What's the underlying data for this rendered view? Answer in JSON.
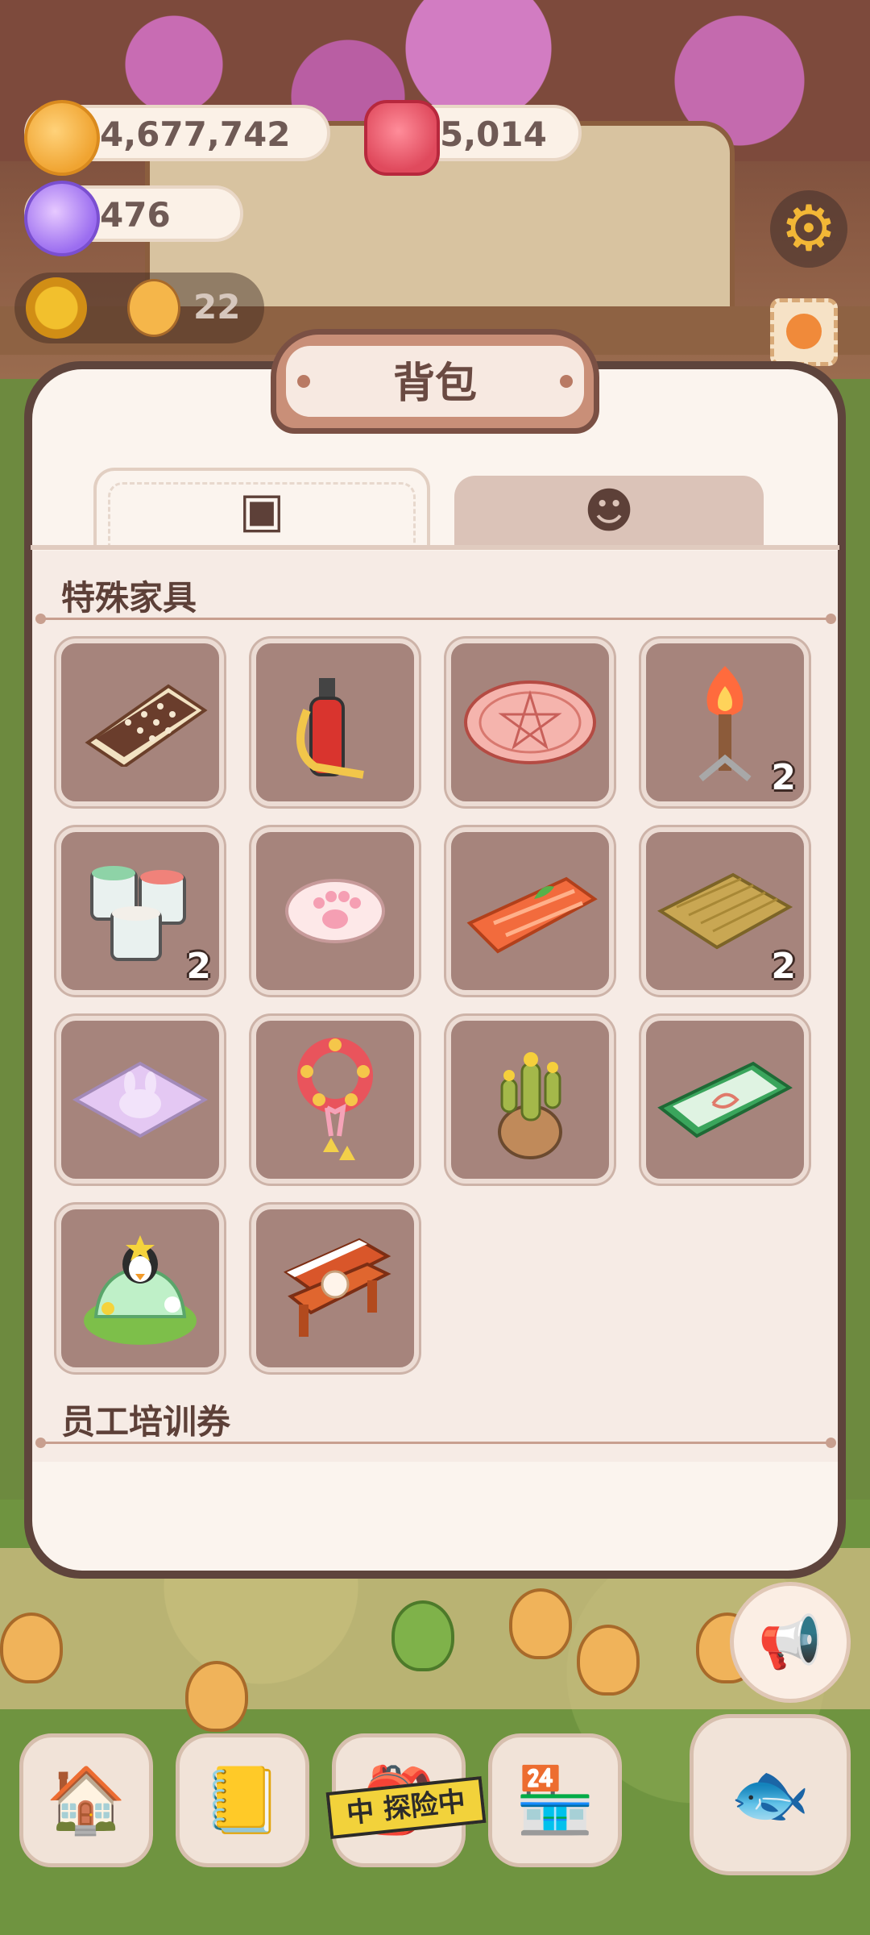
{
  "hud": {
    "coins": "4,677,742",
    "candles": "5,014",
    "gems": "476",
    "staff_count": "22",
    "icons": [
      "coin-icon",
      "candle-icon",
      "gem-icon",
      "sunflower-icon",
      "gear-icon",
      "stamp-icon"
    ]
  },
  "backpack": {
    "title": "背包",
    "tabs": [
      {
        "name": "furniture",
        "icon": "furniture-box-icon",
        "active": true
      },
      {
        "name": "staff",
        "icon": "chef-cat-icon",
        "active": false
      }
    ],
    "sections": [
      {
        "title": "特殊家具",
        "items": [
          {
            "name": "chocolate-biscuit-rug",
            "count": ""
          },
          {
            "name": "fire-extinguisher",
            "count": ""
          },
          {
            "name": "pentagram-rug",
            "count": ""
          },
          {
            "name": "torch",
            "count": "2"
          },
          {
            "name": "paint-buckets",
            "count": "2"
          },
          {
            "name": "paw-print-rug",
            "count": ""
          },
          {
            "name": "salmon-cushion",
            "count": ""
          },
          {
            "name": "bamboo-mat",
            "count": "2"
          },
          {
            "name": "bunny-rug",
            "count": ""
          },
          {
            "name": "flower-wreath",
            "count": ""
          },
          {
            "name": "cactus-pot",
            "count": ""
          },
          {
            "name": "green-rug",
            "count": ""
          },
          {
            "name": "penguin-jelly-cake",
            "count": ""
          },
          {
            "name": "snowy-bench",
            "count": ""
          }
        ]
      },
      {
        "title": "员工培训券",
        "items": []
      }
    ]
  },
  "nav": {
    "explore_label": "中 探险中",
    "buttons": [
      "mushroom-house-icon",
      "notebook-icon",
      "explore-icon",
      "shop-icon",
      "fish-clock-icon"
    ],
    "notice_icon": "megaphone-icon"
  },
  "colors": {
    "panel_bg": "#fbf4ee",
    "panel_border": "#5e443c",
    "slot_bg": "#a6847c",
    "text_dark": "#5d4038"
  }
}
